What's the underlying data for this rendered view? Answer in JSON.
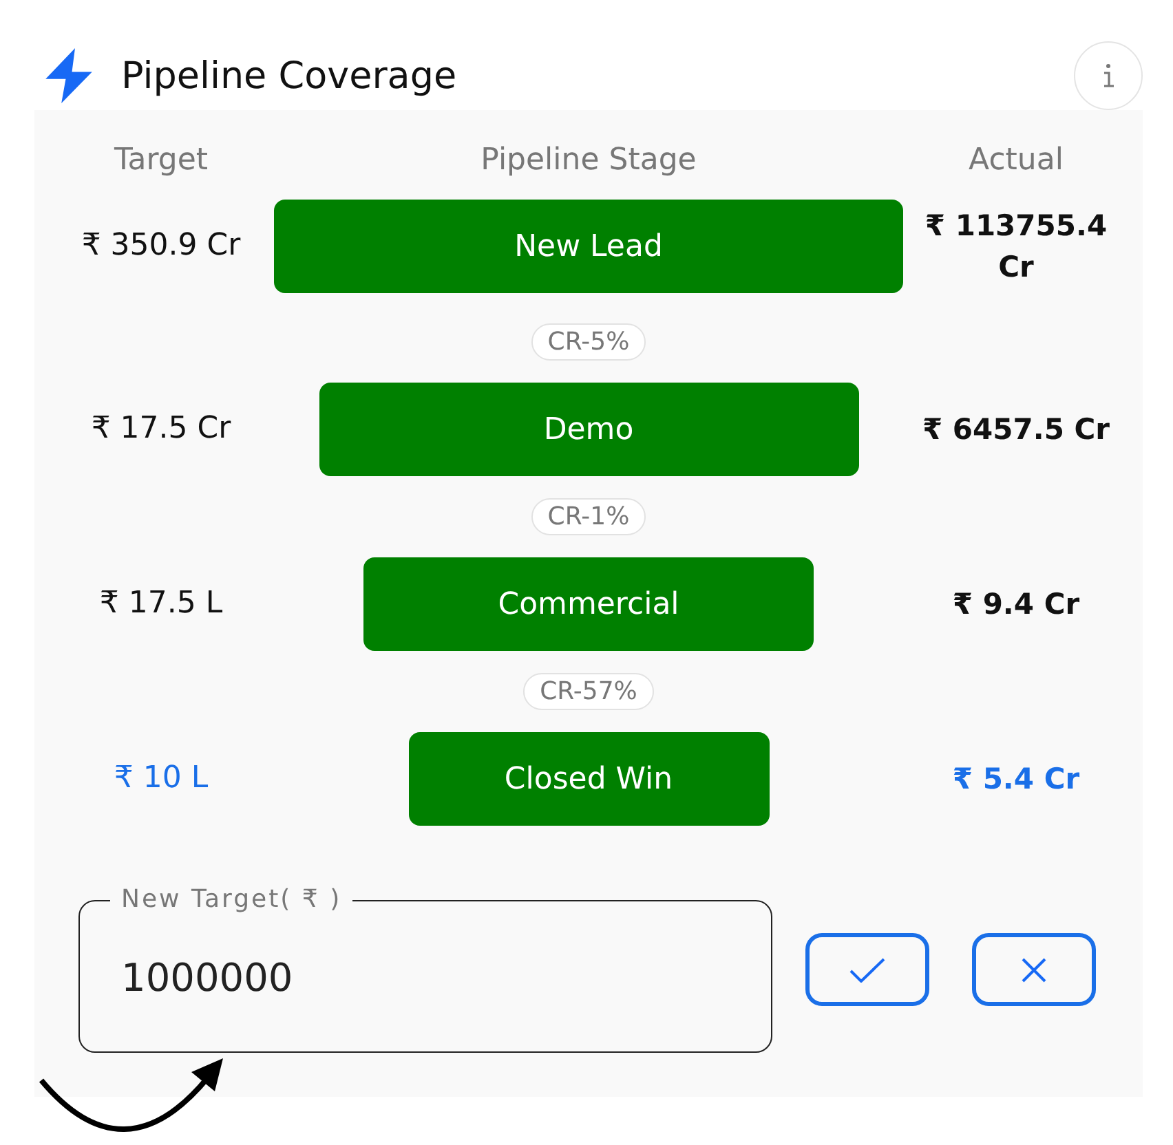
{
  "header": {
    "title": "Pipeline Coverage"
  },
  "table": {
    "columns": [
      "Target",
      "Pipeline Stage",
      "Actual"
    ],
    "stages": [
      {
        "target": "₹ 350.9 Cr",
        "name": "New Lead",
        "actual": "₹ 113755.4 Cr",
        "selected": false,
        "rate_to_next": "CR-5%"
      },
      {
        "target": "₹ 17.5 Cr",
        "name": "Demo",
        "actual": "₹ 6457.5 Cr",
        "selected": false,
        "rate_to_next": "CR-1%"
      },
      {
        "target": "₹ 17.5 L",
        "name": "Commercial",
        "actual": "₹ 9.4 Cr",
        "selected": false,
        "rate_to_next": "CR-57%"
      },
      {
        "target": "₹ 10 L",
        "name": "Closed Win",
        "actual": "₹ 5.4 Cr",
        "selected": true
      }
    ]
  },
  "form": {
    "label": "New Target( ₹ )",
    "value": "1000000"
  }
}
